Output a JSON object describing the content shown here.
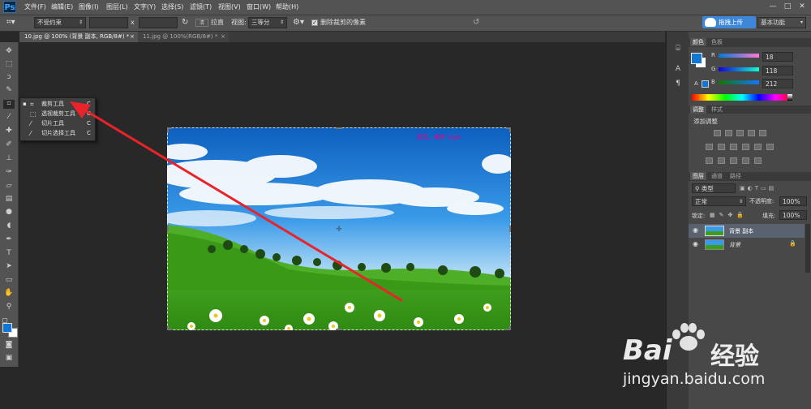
{
  "app": {
    "logo": "Ps"
  },
  "menu": [
    "文件(F)",
    "编辑(E)",
    "图像(I)",
    "图层(L)",
    "文字(Y)",
    "选择(S)",
    "滤镜(T)",
    "视图(V)",
    "窗口(W)",
    "帮助(H)"
  ],
  "window_controls": [
    "—",
    "□",
    "✕"
  ],
  "options": {
    "constraint": "不受约束",
    "x_sep": "x",
    "straighten": "拉直",
    "view_label": "视图:",
    "view_value": "三等分",
    "delete_pixels": "删除裁剪的像素",
    "cloud_btn": "拖拽上传",
    "workspace": "基本功能"
  },
  "tabs": [
    {
      "label": "10.jpg @ 100% (背景 副本, RGB/8#) *",
      "close": "×"
    },
    {
      "label": "11.jpg @ 100%(RGB/8#) *",
      "close": "×"
    }
  ],
  "flyout": [
    {
      "label": "裁剪工具",
      "shortcut": "C",
      "active": true
    },
    {
      "label": "透视裁剪工具",
      "shortcut": "C",
      "active": false
    },
    {
      "label": "切片工具",
      "shortcut": "C",
      "active": false
    },
    {
      "label": "切片选择工具",
      "shortcut": "C",
      "active": false
    }
  ],
  "canvas": {
    "overlay_text": "修改、裁剪 Logo"
  },
  "color_panel": {
    "tabs": [
      "颜色",
      "色板"
    ],
    "R": "18",
    "G": "118",
    "B": "212",
    "fg": "#1276d4",
    "bg": "#ffffff"
  },
  "adjust_panel": {
    "tabs": [
      "调整",
      "样式"
    ],
    "title": "添加调整"
  },
  "layers_panel": {
    "tabs": [
      "图层",
      "通道",
      "路径"
    ],
    "filter": "类型",
    "blend": "正常",
    "opacity_label": "不透明度:",
    "opacity": "100%",
    "lock_label": "锁定:",
    "fill_label": "填充:",
    "fill": "100%",
    "layers": [
      {
        "name": "背景 副本",
        "selected": true
      },
      {
        "name": "背景",
        "selected": false
      }
    ]
  },
  "watermark": {
    "brand_left": "Bai",
    "brand_right": "经验",
    "url": "jingyan.baidu.com"
  },
  "colors": {
    "accent": "#3e87d8",
    "arrow": "#e8232a"
  }
}
